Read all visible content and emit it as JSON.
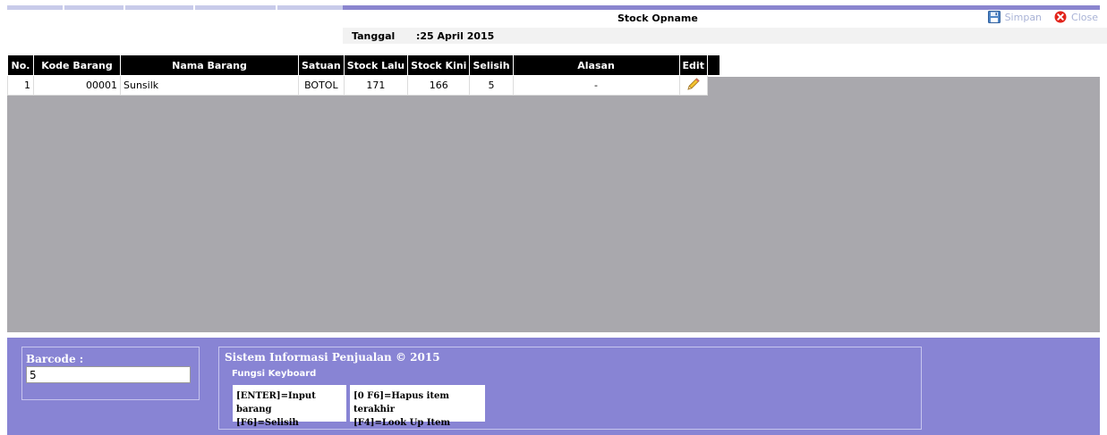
{
  "window": {
    "title": "Stock Opname"
  },
  "toolbar": {
    "save_label": "Simpan",
    "close_label": "Close"
  },
  "date": {
    "label": "Tanggal",
    "value": ":25 April 2015"
  },
  "table": {
    "headers": [
      "No.",
      "Kode Barang",
      "Nama Barang",
      "Satuan",
      "Stock Lalu",
      "Stock Kini",
      "Selisih",
      "Alasan",
      "Edit"
    ],
    "rows": [
      {
        "no": "1",
        "kode": "00001",
        "nama": "Sunsilk",
        "satuan": "BOTOL",
        "stock_lalu": "171",
        "stock_kini": "166",
        "selisih": "5",
        "alasan": "-"
      }
    ]
  },
  "barcode": {
    "label": "Barcode :",
    "value": "5"
  },
  "info": {
    "title": "Sistem Informasi Penjualan © 2015",
    "subtitle": "Fungsi Keyboard",
    "keys_left": [
      "[ENTER]=Input barang",
      "[F6]=Selisih"
    ],
    "keys_right": [
      "[0 F6]=Hapus item terakhir",
      "[F4]=Look Up Item"
    ]
  },
  "icons": {
    "save": "floppy-disk-icon",
    "close": "close-circle-icon",
    "edit": "pencil-icon"
  },
  "colors": {
    "footer_bg": "#8884d4",
    "grid_bg": "#a9a8ad",
    "header_bg": "#000000",
    "toolbar_text": "#a9b3d6",
    "close_red": "#e2231a"
  }
}
